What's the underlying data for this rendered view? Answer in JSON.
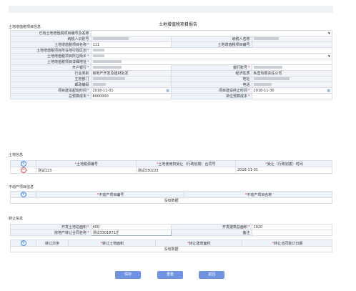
{
  "title": "土地增值税项目报告",
  "sections": {
    "project_info": "土地增值税项目信息",
    "land_info": "土地信息",
    "property_info": "不动产项目信息",
    "transfer_info": "转让信息"
  },
  "project": {
    "existing_label": "已有土地增值税项目编号及名称",
    "taxpayer_id_label": "纳税人识别号",
    "taxpayer_name_label": "纳税人名称",
    "project_name_label": "土地增值税项目名称",
    "project_name_value": "111",
    "project_no_label": "土地增值税项目编号",
    "district_label": "土地增值税项目所在地行政区划",
    "street_label": "土地增值税项目所在街乡",
    "address_label": "土地增值税项目详细地址",
    "bank_label": "开户银行",
    "account_label": "银行账号",
    "industry_label": "行业类别",
    "industry_value": "房地产开发及建材批发",
    "economy_label": "经济性质",
    "economy_value": "私营有限责任公司",
    "authority_label": "主管部门",
    "addr_label": "地址",
    "postcode_label": "邮政编码",
    "phone_label": "电话",
    "start_label": "项目建设起始时间",
    "start_value": "2018-11-01",
    "end_label": "项目建设终止时间",
    "end_value": "2018-11-30",
    "total_cost_label": "总预算成本",
    "total_cost_value": "6000000",
    "unit_cost_label": "单位预算成本"
  },
  "land": {
    "headers": [
      "土地税源编号",
      "土地使用权受让（行政划拨）合同号",
      "受让（行政划拨）时间"
    ],
    "row": [
      "测试123",
      "测试330223",
      "2018-11-01"
    ]
  },
  "property": {
    "headers": [
      "不动产项目编号",
      "不动产项目名称"
    ],
    "empty_text": "没有数据"
  },
  "transfer": {
    "land_area_label": "开发土地总面积",
    "land_area_value": "400",
    "building_area_label": "开发建筑总面积",
    "building_area_value": "1920",
    "contract_label": "房地产转让合同名称",
    "contract_value": "测试3301871迁",
    "remark_label": "备注",
    "headers": [
      "转让次序",
      "转让土地面积",
      "转让建筑面积",
      "转让合同签订日期"
    ],
    "empty_text": "没有数据"
  },
  "buttons": {
    "save": "保存",
    "reset": "重置",
    "back": "返回"
  }
}
